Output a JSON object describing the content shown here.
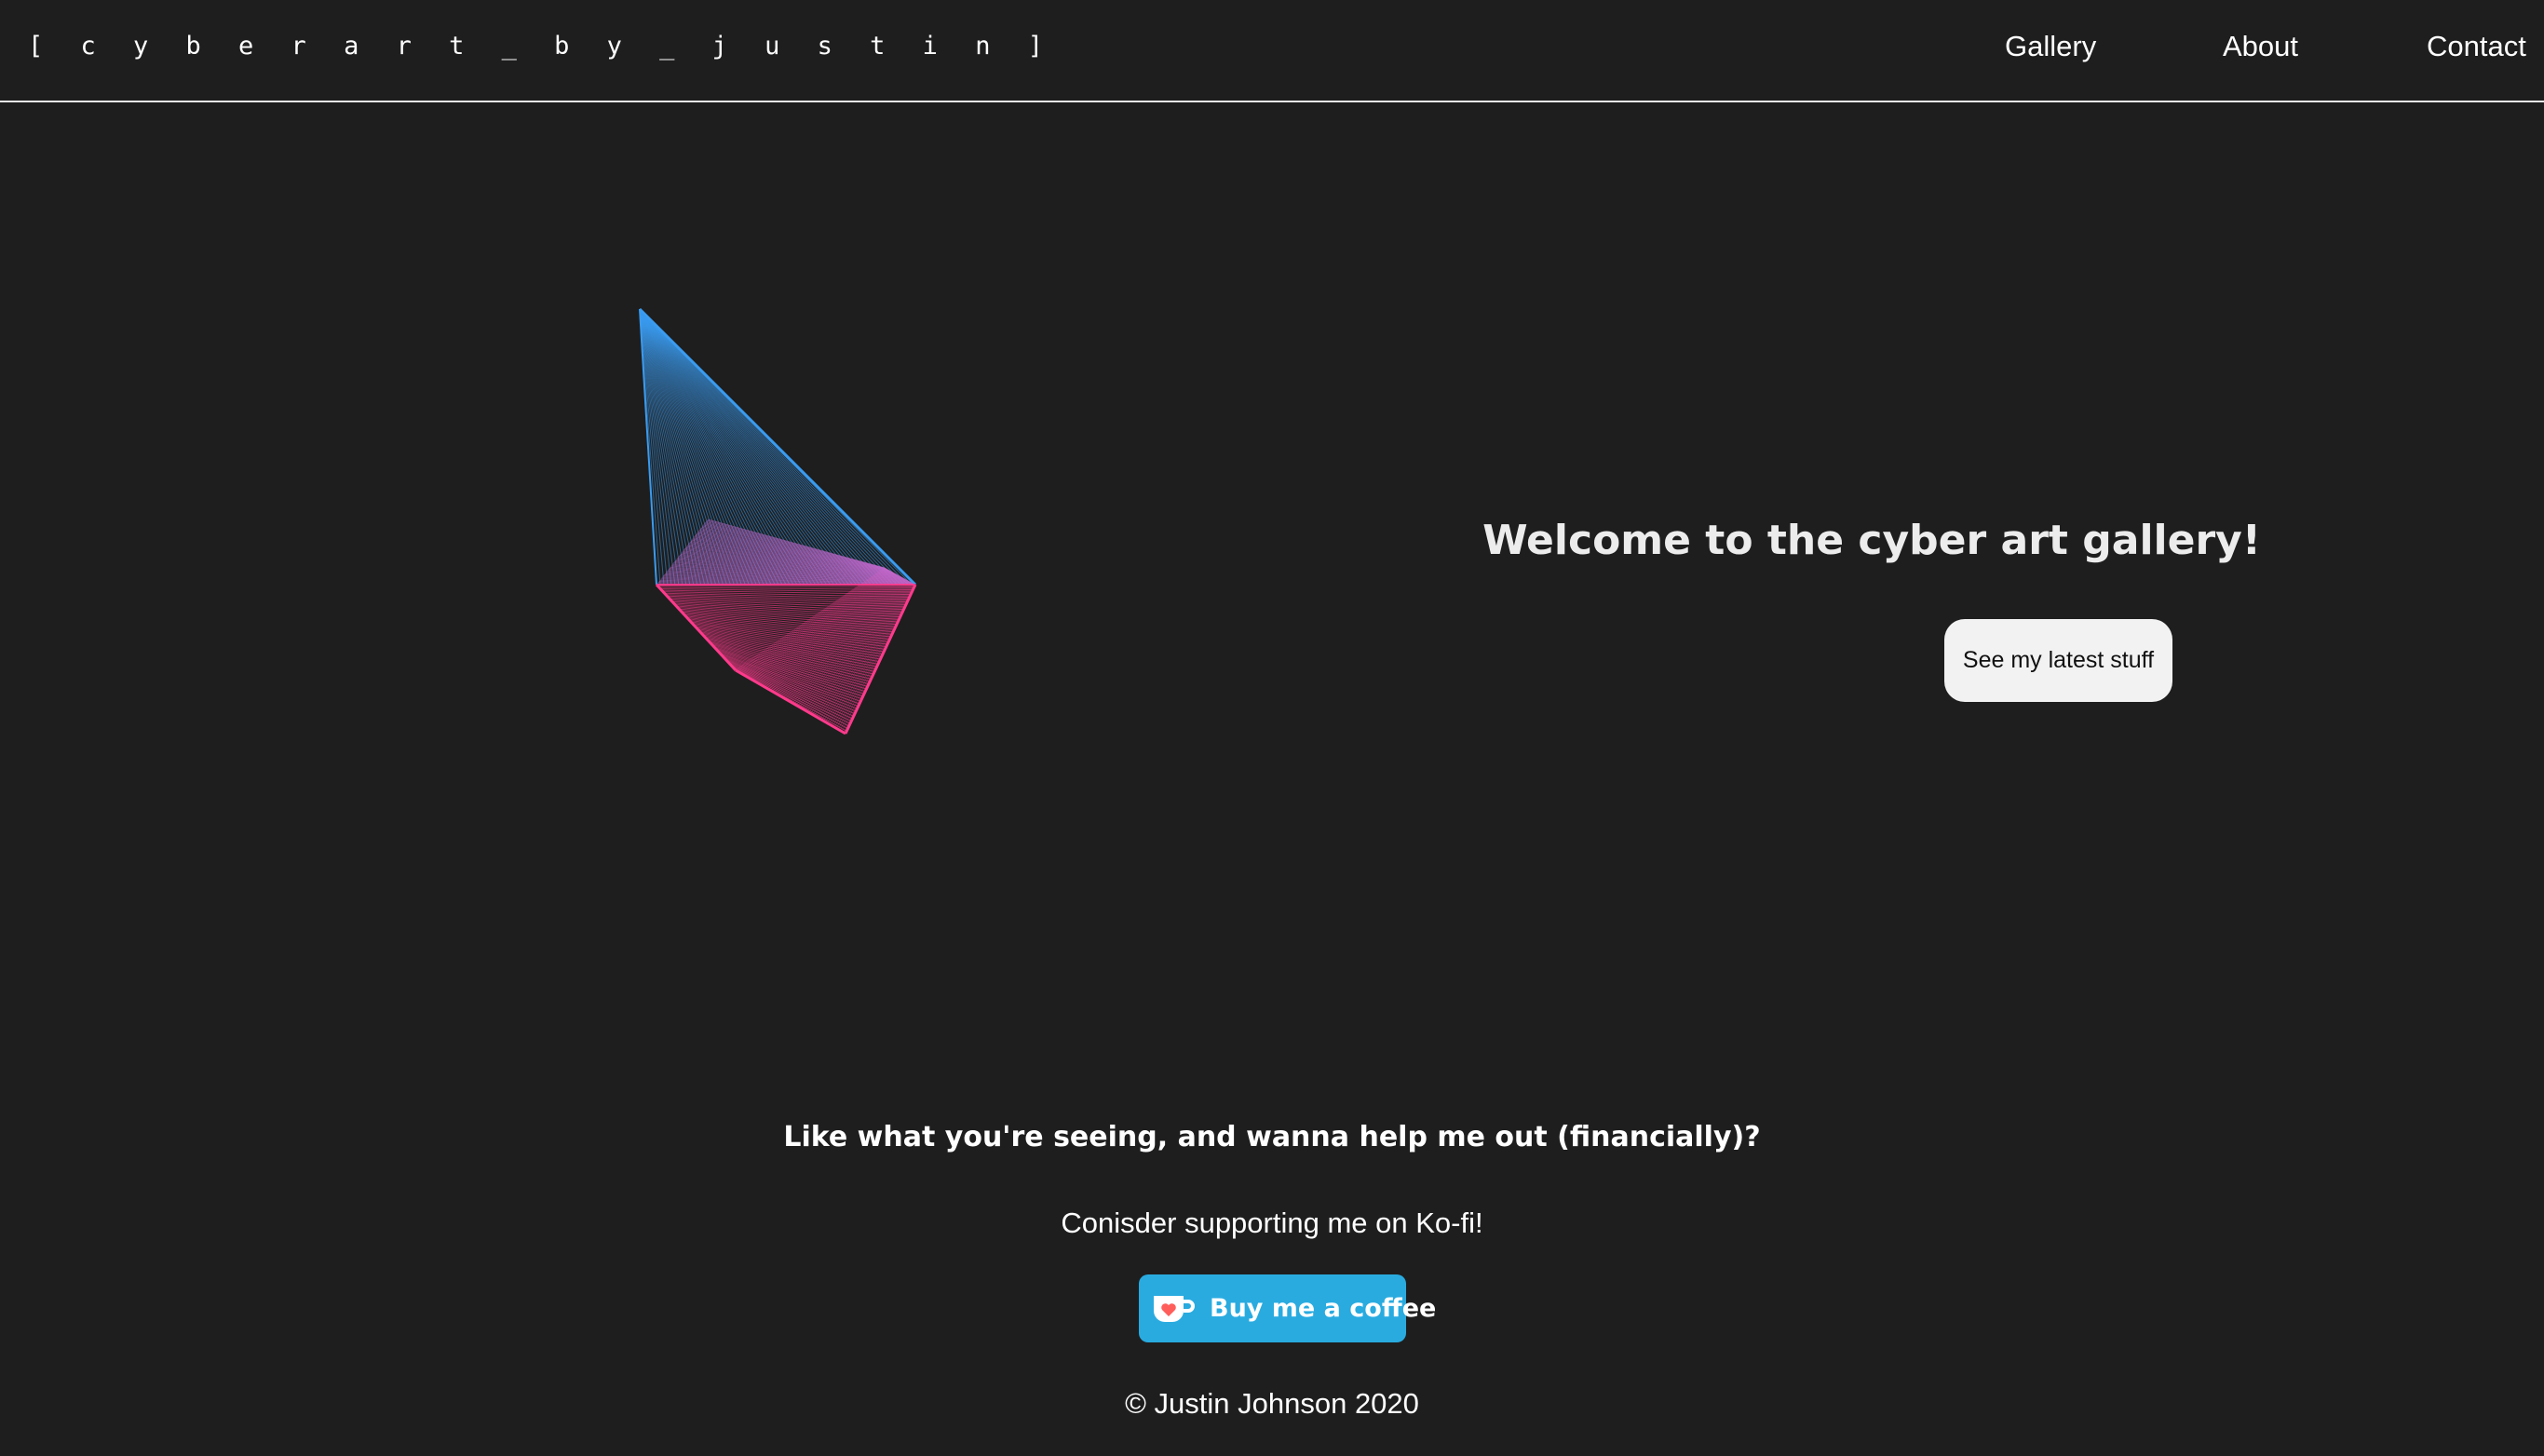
{
  "header": {
    "brand": "[ c y b e r a r t _ b y _ j u s t i n ]",
    "nav": [
      {
        "label": "Gallery"
      },
      {
        "label": "About"
      },
      {
        "label": "Contact"
      }
    ]
  },
  "hero": {
    "title": "Welcome to the cyber art gallery!",
    "cta_label": "See my latest stuff"
  },
  "support": {
    "question": "Like what you're seeing, and wanna help me out (financially)?",
    "sub": "Conisder supporting me on Ko-fi!",
    "button_label": "Buy me a coffee",
    "button_icon": "kofi-cup-icon"
  },
  "footer": {
    "copyright": "© Justin Johnson 2020"
  },
  "colors": {
    "background": "#1e1e1e",
    "art_blue": "#3a9bef",
    "art_pink": "#ff3a8c",
    "kofi_blue": "#29abe0",
    "cta_bg": "#f2f2f2"
  }
}
